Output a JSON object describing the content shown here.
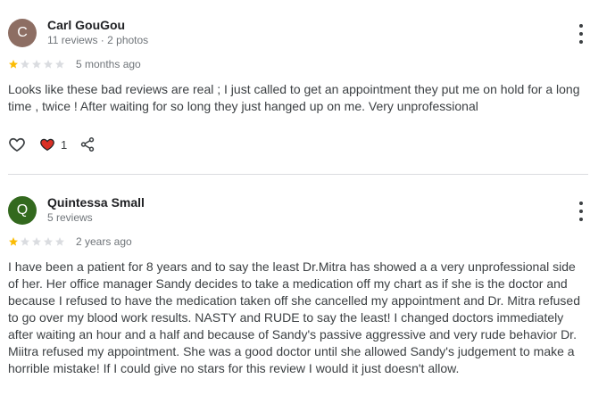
{
  "reviews": [
    {
      "avatar_letter": "C",
      "avatar_color": "#8d6e63",
      "name": "Carl GouGou",
      "meta": "11 reviews · 2 photos",
      "rating": 1,
      "time": "5 months ago",
      "text": "Looks like these bad reviews are real ; I just called to get an appointment they put me on hold for a long time , twice ! After waiting for so long they just hanged up on me. Very unprofessional",
      "reaction_count": "1"
    },
    {
      "avatar_letter": "Q",
      "avatar_color": "#33691e",
      "name": "Quintessa Small",
      "meta": "5 reviews",
      "rating": 1,
      "time": "2 years ago",
      "text": "I have been a patient for 8 years and to say the least Dr.Mitra has showed a a very unprofessional side of her. Her office manager Sandy decides to take a medication off my chart as if she is the doctor and because I refused to have the medication taken off she cancelled my appointment and Dr. Mitra refused to go over my blood work results. NASTY and RUDE to say the least! I changed doctors immediately after waiting an hour and a half and because of Sandy's passive aggressive and very rude behavior Dr. Miitra refused my appointment. She was a good doctor until she allowed Sandy's judgement to make a horrible mistake! If I could give no stars for this review I would it just doesn't allow."
    }
  ],
  "colors": {
    "star_filled": "#fbbc04",
    "star_empty": "#dadce0",
    "heart_filled": "#d93025"
  }
}
